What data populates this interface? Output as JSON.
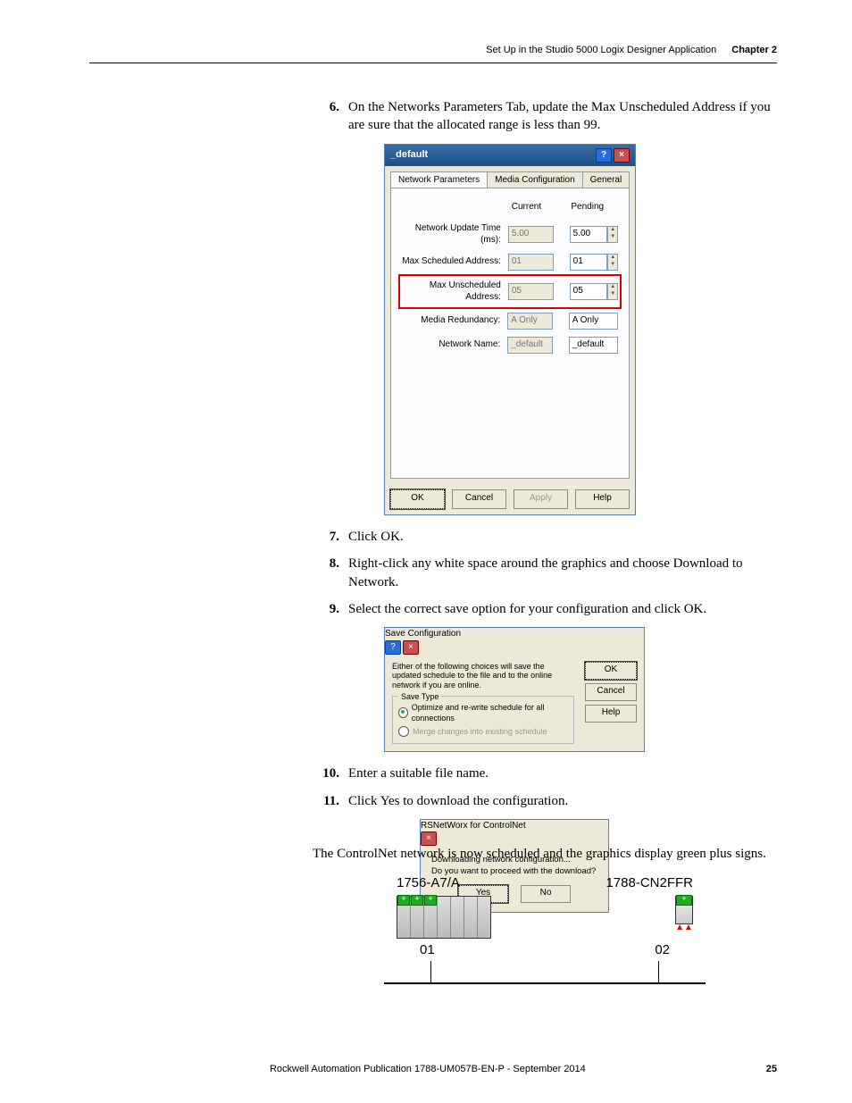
{
  "header": {
    "section": "Set Up in the Studio 5000 Logix Designer Application",
    "chapter": "Chapter 2"
  },
  "steps": {
    "s6": "On the Networks Parameters Tab, update the Max Unscheduled Address if you are sure that the allocated range is less than 99.",
    "s7": "Click OK.",
    "s8": "Right-click any white space around the graphics and choose Download to Network.",
    "s9": "Select the correct save option for your configuration and click OK.",
    "s10": "Enter a suitable file name.",
    "s11": "Click Yes to download the configuration."
  },
  "dlg1": {
    "title": "_default",
    "tabs": {
      "t1": "Network Parameters",
      "t2": "Media Configuration",
      "t3": "General"
    },
    "col_current": "Current",
    "col_pending": "Pending",
    "rows": {
      "nut_label": "Network Update Time (ms):",
      "nut_cur": "5.00",
      "nut_pend": "5.00",
      "msa_label": "Max Scheduled Address:",
      "msa_cur": "01",
      "msa_pend": "01",
      "mua_label": "Max Unscheduled Address:",
      "mua_cur": "05",
      "mua_pend": "05",
      "mr_label": "Media Redundancy:",
      "mr_cur": "A Only",
      "mr_pend": "A Only",
      "nn_label": "Network Name:",
      "nn_cur": "_default",
      "nn_pend": "_default"
    },
    "btn_ok": "OK",
    "btn_cancel": "Cancel",
    "btn_apply": "Apply",
    "btn_help": "Help"
  },
  "dlg2": {
    "title": "Save Configuration",
    "intro": "Either of the following choices will save the updated schedule to the file and to the online network if you are online.",
    "legend": "Save Type",
    "opt1": "Optimize and re-write schedule for all connections",
    "opt2": "Merge changes into existing schedule",
    "btn_ok": "OK",
    "btn_cancel": "Cancel",
    "btn_help": "Help"
  },
  "dlg3": {
    "title": "RSNetWorx for ControlNet",
    "line1": "Downloading network configuration...",
    "line2": "Do you want to proceed with the download?",
    "btn_yes": "Yes",
    "btn_no": "No"
  },
  "outro": "The ControlNet network is now scheduled and the graphics display green plus signs.",
  "net": {
    "label1": "1756-A7/A",
    "label2": "1788-CN2FFR",
    "id1": "01",
    "id2": "02"
  },
  "footer": {
    "pub": "Rockwell Automation Publication 1788-UM057B-EN-P - September 2014",
    "page": "25"
  }
}
